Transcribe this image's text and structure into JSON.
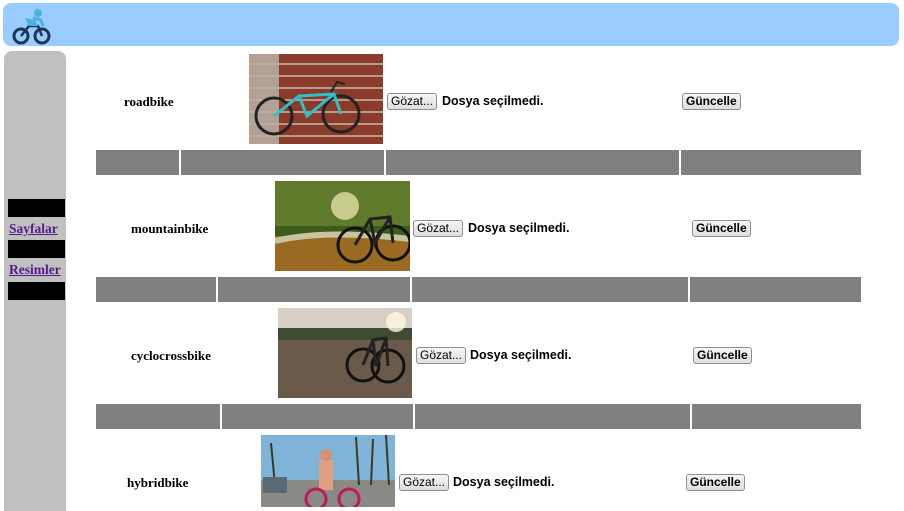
{
  "header": {
    "logo_icon": "cyclist-icon",
    "background": "#99ccff"
  },
  "sidebar": {
    "links": [
      {
        "label": "Sayfalar"
      },
      {
        "label": "Resimler"
      }
    ],
    "link_color": "#551a8b"
  },
  "rows": [
    {
      "name": "roadbike",
      "browse_label": "Gözat...",
      "file_status": "Dosya seçilmedi.",
      "update_label": "Güncelle",
      "image": "road-bike-against-brick-wall"
    },
    {
      "name": "mountainbike",
      "browse_label": "Gözat...",
      "file_status": "Dosya seçilmedi.",
      "update_label": "Güncelle",
      "image": "mountain-bike-in-autumn-forest"
    },
    {
      "name": "cyclocrossbike",
      "browse_label": "Gözat...",
      "file_status": "Dosya seçilmedi.",
      "update_label": "Güncelle",
      "image": "cyclocross-bike-on-dirt-field"
    },
    {
      "name": "hybridbike",
      "browse_label": "Gözat...",
      "file_status": "Dosya seçilmedi.",
      "update_label": "Güncelle",
      "image": "woman-with-hybrid-bike-palm-street"
    }
  ]
}
